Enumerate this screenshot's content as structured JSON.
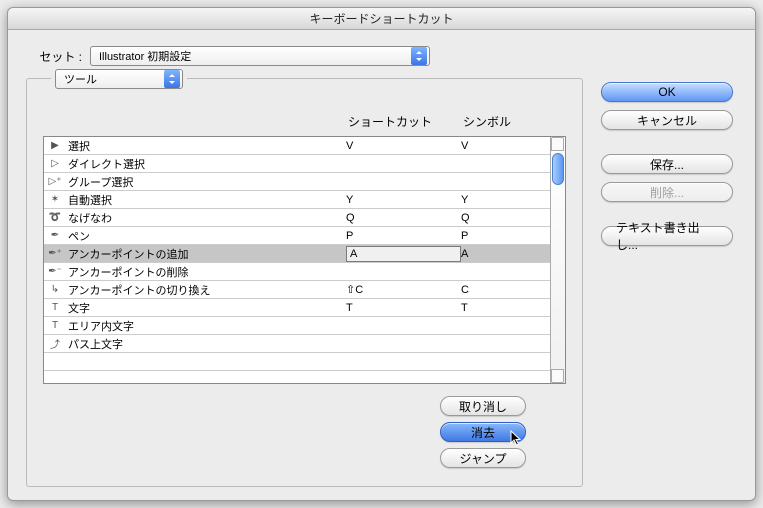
{
  "title": "キーボードショートカット",
  "set": {
    "label": "セット :",
    "value": "Illustrator 初期設定"
  },
  "toolsDropdown": {
    "value": "ツール"
  },
  "columns": {
    "shortcut": "ショートカット",
    "symbol": "シンボル"
  },
  "rows": [
    {
      "icon": "arrow",
      "name": "選択",
      "shortcut": "V",
      "symbol": "V",
      "selected": false
    },
    {
      "icon": "darrow",
      "name": "ダイレクト選択",
      "shortcut": "",
      "symbol": "",
      "selected": false
    },
    {
      "icon": "garrow",
      "name": "グループ選択",
      "shortcut": "",
      "symbol": "",
      "selected": false
    },
    {
      "icon": "wand",
      "name": "自動選択",
      "shortcut": "Y",
      "symbol": "Y",
      "selected": false
    },
    {
      "icon": "lasso",
      "name": "なげなわ",
      "shortcut": "Q",
      "symbol": "Q",
      "selected": false
    },
    {
      "icon": "pen",
      "name": "ペン",
      "shortcut": "P",
      "symbol": "P",
      "selected": false
    },
    {
      "icon": "pen+",
      "name": "アンカーポイントの追加",
      "shortcut": "A",
      "symbol": "A",
      "selected": true
    },
    {
      "icon": "pen-",
      "name": "アンカーポイントの削除",
      "shortcut": "",
      "symbol": "",
      "selected": false
    },
    {
      "icon": "conv",
      "name": "アンカーポイントの切り換え",
      "shortcut": "⇧C",
      "symbol": "C",
      "selected": false
    },
    {
      "icon": "T",
      "name": "文字",
      "shortcut": "T",
      "symbol": "T",
      "selected": false
    },
    {
      "icon": "Ta",
      "name": "エリア内文字",
      "shortcut": "",
      "symbol": "",
      "selected": false
    },
    {
      "icon": "Tp",
      "name": "パス上文字",
      "shortcut": "",
      "symbol": "",
      "selected": false
    }
  ],
  "underButtons": {
    "undo": "取り消し",
    "clear": "消去",
    "jump": "ジャンプ"
  },
  "sideButtons": {
    "ok": "OK",
    "cancel": "キャンセル",
    "save": "保存...",
    "delete": "削除...",
    "export": "テキスト書き出し..."
  }
}
